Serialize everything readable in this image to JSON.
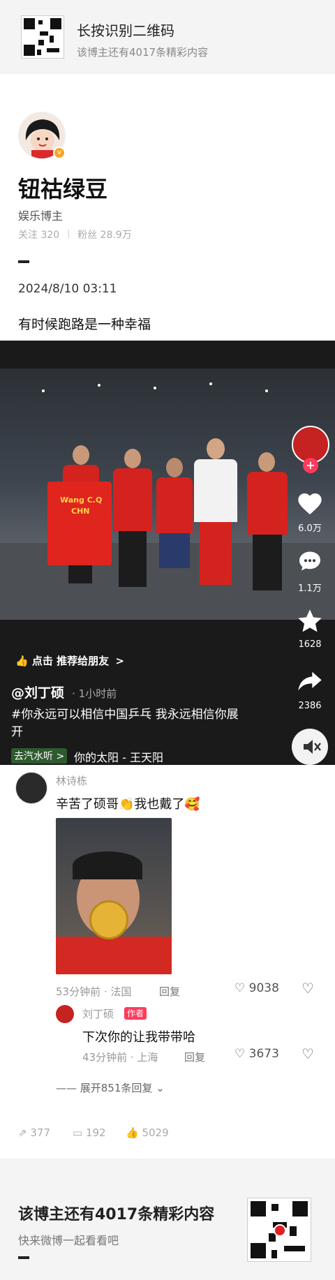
{
  "top_banner": {
    "title": "长按识别二维码",
    "subtitle": "该博主还有4017条精彩内容"
  },
  "profile": {
    "name": "钮祜绿豆",
    "role": "娱乐博主",
    "follow_label": "关注",
    "follow_count": "320",
    "fans_label": "粉丝",
    "fans_count": "28.9万",
    "date": "2024/8/10 03:11",
    "post_text": "有时候跑路是一种幸福"
  },
  "video": {
    "shirt_text_1": "Wang C.Q",
    "shirt_text_2": "CHN",
    "share_prompt": "点击 推荐给朋友",
    "share_chevron": ">",
    "author": "@刘丁硕",
    "time": "· 1小时前",
    "caption": "#你永远可以相信中国乒乓 我永远相信你展开",
    "music_tag": "去汽水听 >",
    "music": "你的太阳 - 王天阳",
    "side": {
      "likes": "6.0万",
      "comments": "1.1万",
      "favorites": "1628",
      "shares": "2386"
    }
  },
  "comments": {
    "c1": {
      "user": "林诗栋",
      "text": "辛苦了硕哥👏我也戴了🥰",
      "meta": "53分钟前 · 法国",
      "reply": "回复",
      "likes": "9038"
    },
    "c2": {
      "user": "刘丁硕",
      "badge": "作者",
      "text": "下次你的让我带带哈",
      "meta": "43分钟前 · 上海",
      "reply": "回复",
      "likes": "3673"
    },
    "expand": "—— 展开851条回复 ⌄"
  },
  "stats": {
    "reposts": "377",
    "comments": "192",
    "likes": "5029"
  },
  "bottom_banner": {
    "title": "该博主还有4017条精彩内容",
    "subtitle": "快来微博一起看看吧"
  },
  "colors": {
    "accent_red": "#e02020",
    "author_badge": "#ff3b5c",
    "video_bg": "#1a1a1a"
  },
  "icons": [
    "qr-code-icon",
    "avatar",
    "heart-icon",
    "comment-icon",
    "star-icon",
    "share-icon",
    "mute-icon",
    "thumb-icon",
    "repost-icon"
  ]
}
